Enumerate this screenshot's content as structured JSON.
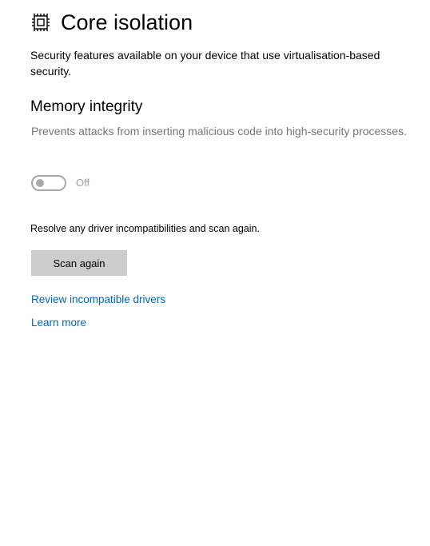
{
  "header": {
    "icon": "core-isolation-chip-icon",
    "title": "Core isolation"
  },
  "description": "Security features available on your device that use virtualisation-based security.",
  "memory_integrity": {
    "title": "Memory integrity",
    "description": "Prevents attacks from inserting malicious code into high-security processes.",
    "toggle": {
      "state": false,
      "label": "Off"
    }
  },
  "resolve_text": "Resolve any driver incompatibilities and scan again.",
  "scan_button_label": "Scan again",
  "links": {
    "review": "Review incompatible drivers",
    "learn_more": "Learn more"
  },
  "colors": {
    "link": "#0067b8",
    "button_bg": "#cccccc",
    "disabled": "#a8a8a8",
    "muted_text": "#767676"
  }
}
